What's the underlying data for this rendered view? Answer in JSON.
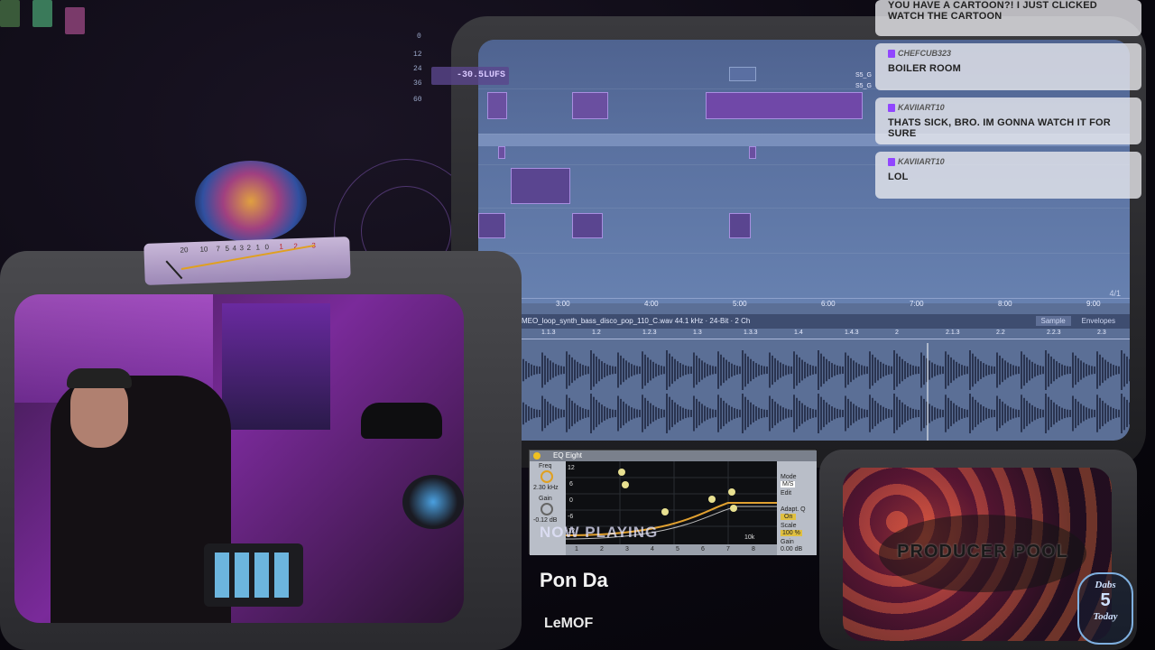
{
  "daw": {
    "lufs_label": "-30.5LUFS",
    "db_scale": [
      "0",
      "12",
      "24",
      "36",
      "60"
    ],
    "timeline_ticks": [
      "3:00",
      "4:00",
      "5:00",
      "6:00",
      "7:00",
      "8:00",
      "9:00"
    ],
    "time_signature": "4/1",
    "clip_name": "ROMEO_loop_synth_bass_disco_pop_110_C.wav 44.1 kHz · 24-Bit · 2 Ch",
    "clip_tabs": [
      "Sample",
      "Envelopes"
    ],
    "clip_ruler": [
      "1.1.3",
      "1.2",
      "1.2.3",
      "1.3",
      "1.3.3",
      "1.4",
      "1.4.3",
      "2",
      "2.1.3",
      "2.2",
      "2.2.3",
      "2.3"
    ],
    "clip_markers": [
      "S5_G",
      "S5_G"
    ]
  },
  "chat": {
    "messages": [
      {
        "user": "",
        "text": "YOU HAVE A CARTOON?! I JUST CLICKED WATCH THE CARTOON"
      },
      {
        "user": "CHEFCUB323",
        "text": "BOILER ROOM"
      },
      {
        "user": "KAVIIART10",
        "text": "THATS SICK, BRO. IM GONNA WATCH IT FOR SURE"
      },
      {
        "user": "KAVIIART10",
        "text": "LOL"
      }
    ]
  },
  "vu_meter": {
    "scale": [
      "20",
      "10",
      "7",
      "5",
      "4",
      "3",
      "2",
      "1",
      "0",
      "1",
      "2",
      "3"
    ]
  },
  "eq_plugin": {
    "title": "EQ Eight",
    "freq_label": "Freq",
    "freq_value": "2.30 kHz",
    "gain_label": "Gain",
    "gain_value": "-0.12 dB",
    "db_ticks": [
      "12",
      "6",
      "0",
      "-6",
      "-12"
    ],
    "mode_label": "Mode",
    "mode_value": "M/S",
    "edit_label": "Edit",
    "adapt_label": "Adapt. Q",
    "adapt_value": "On",
    "scale_label": "Scale",
    "scale_value": "100 %",
    "gain_right_label": "Gain",
    "gain_right_value": "0.00 dB",
    "freq_tick": "10k",
    "band_numbers": [
      "1",
      "2",
      "3",
      "4",
      "5",
      "6",
      "7",
      "8"
    ]
  },
  "now_playing": {
    "label": "NOW PLAYING",
    "title": "Pon Da",
    "artist": "LeMOF"
  },
  "producer_pool": {
    "logo_text": "PRODUCER POOL"
  },
  "badge": {
    "top": "Dabs",
    "number": "5",
    "bottom": "Today"
  },
  "colors": {
    "accent_purple": "#9146ff",
    "daw_blue": "#5b6f96"
  }
}
